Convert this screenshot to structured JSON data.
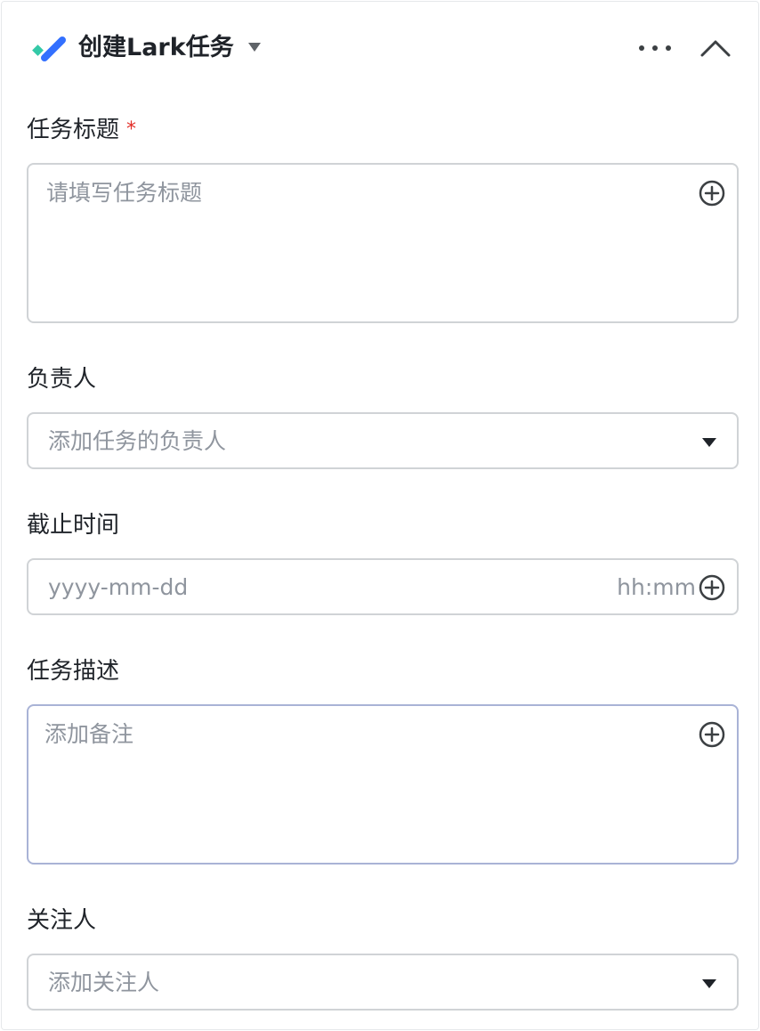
{
  "header": {
    "title": "创建Lark任务",
    "icon": "lark-task-icon",
    "accent_color": "#3370ff",
    "secondary_color": "#34c9a7"
  },
  "form": {
    "task_title": {
      "label": "任务标题",
      "required_mark": "*",
      "placeholder": "请填写任务标题"
    },
    "assignee": {
      "label": "负责人",
      "placeholder": "添加任务的负责人"
    },
    "deadline": {
      "label": "截止时间",
      "date_placeholder": "yyyy-mm-dd",
      "time_placeholder": "hh:mm"
    },
    "description": {
      "label": "任务描述",
      "placeholder": "添加备注"
    },
    "followers": {
      "label": "关注人",
      "placeholder": "添加关注人"
    }
  }
}
